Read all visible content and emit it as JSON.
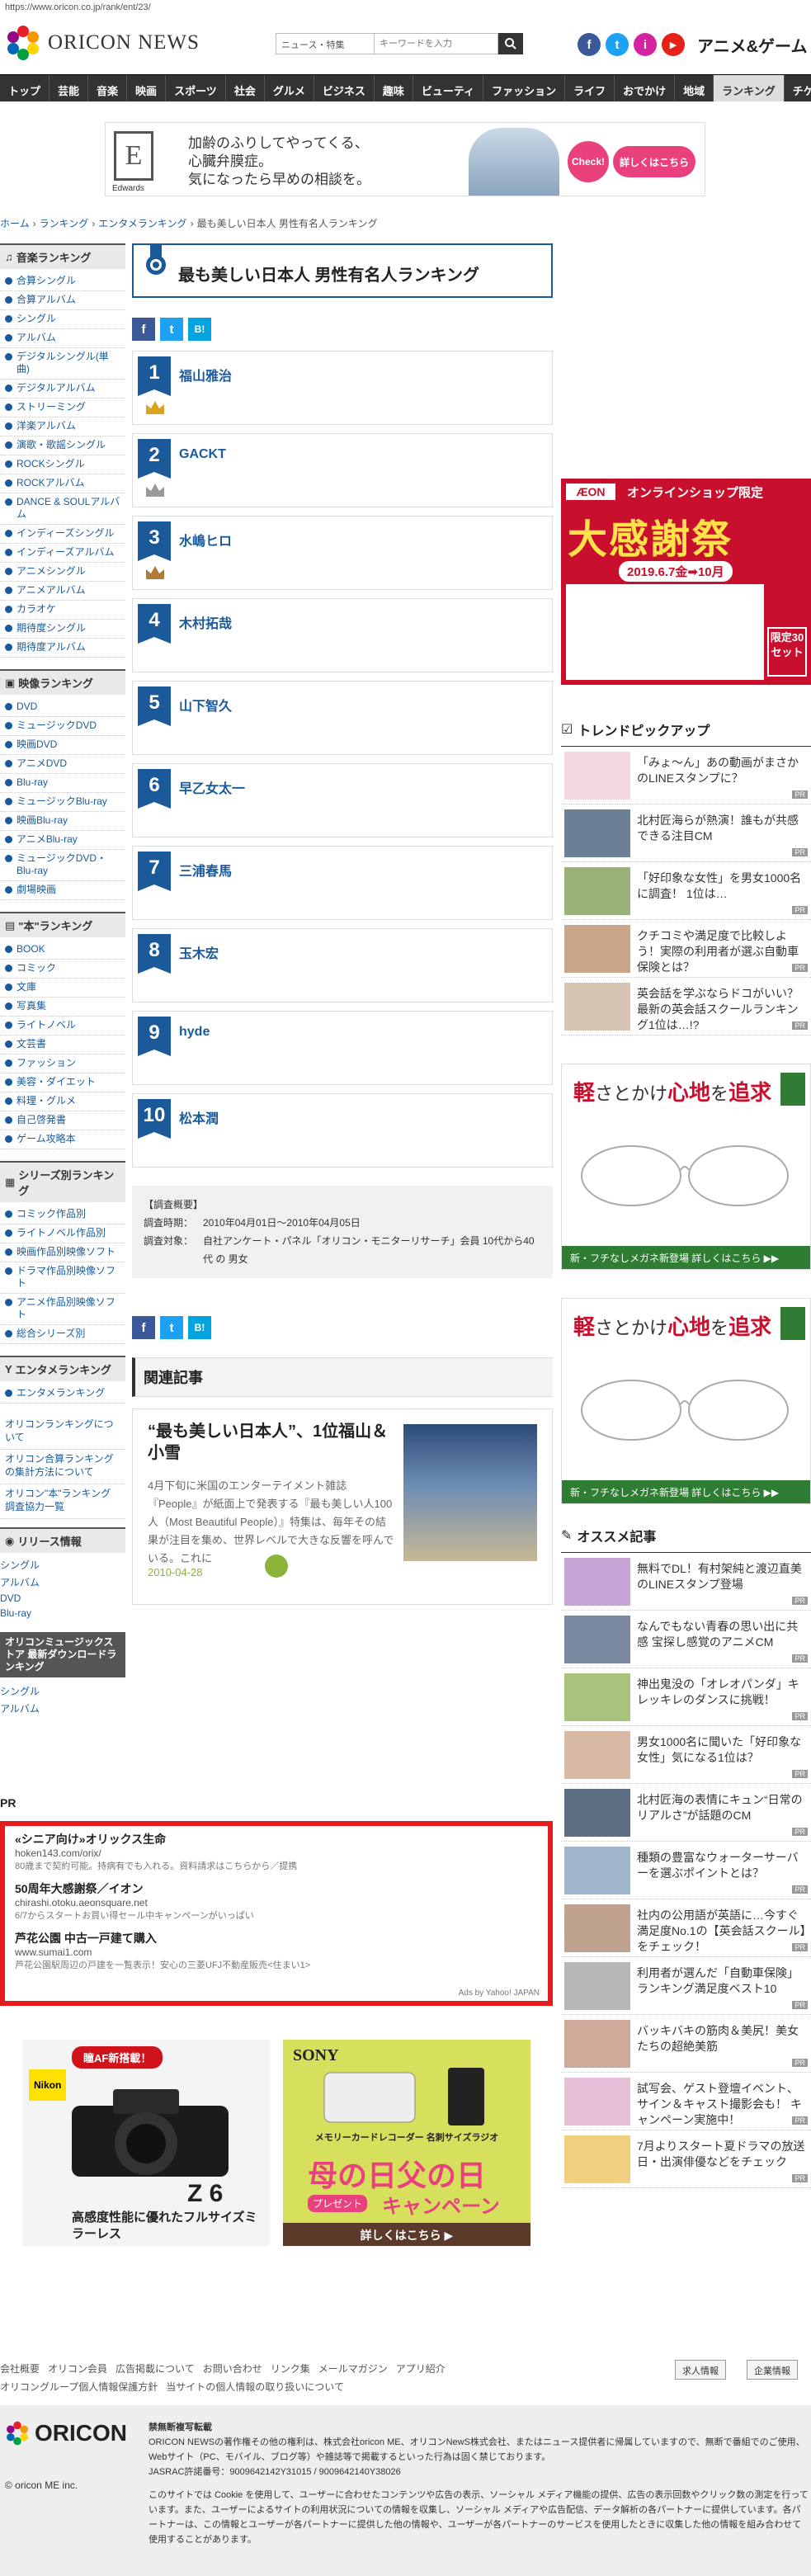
{
  "browser": {
    "url": "https://www.oricon.co.jp/rank/ent/23/"
  },
  "header": {
    "logo_text": "ORICON NEWS",
    "search_category": "ニュース・特集",
    "search_placeholder": "キーワードを入力",
    "sns": [
      "f",
      "t",
      "i",
      "▶"
    ],
    "anime_logo": "アニメ&ゲーム"
  },
  "nav": [
    "トップ",
    "芸能",
    "音楽",
    "映画",
    "スポーツ",
    "社会",
    "グルメ",
    "ビジネス",
    "趣味",
    "ビューティ",
    "ファッション",
    "ライフ",
    "おでかけ",
    "地域",
    "ランキング",
    "チケット"
  ],
  "nav_active": "ランキング",
  "banner_top": {
    "brand_letter": "E",
    "brand": "Edwards",
    "copy": [
      "加齢のふりしてやってくる、",
      "心臓弁膜症。",
      "気になったら早めの相談を。"
    ],
    "check": "Check!",
    "button": "詳しくはこちら"
  },
  "breadcrumb": [
    "ホーム",
    "›",
    "ランキング",
    "›",
    "エンタメランキング",
    "›",
    "最も美しい日本人 男性有名人ランキング"
  ],
  "sidebar": {
    "music_head": "音楽ランキング",
    "music": [
      "合算シングル",
      "合算アルバム",
      "シングル",
      "アルバム",
      "デジタルシングル(単曲)",
      "デジタルアルバム",
      "ストリーミング",
      "洋楽アルバム",
      "演歌・歌謡シングル",
      "ROCKシングル",
      "ROCKアルバム",
      "DANCE & SOULアルバム",
      "インディーズシングル",
      "インディーズアルバム",
      "アニメシングル",
      "アニメアルバム",
      "カラオケ",
      "期待度シングル",
      "期待度アルバム"
    ],
    "video_head": "映像ランキング",
    "video": [
      "DVD",
      "ミュージックDVD",
      "映画DVD",
      "アニメDVD",
      "Blu-ray",
      "ミュージックBlu-ray",
      "映画Blu-ray",
      "アニメBlu-ray",
      "ミュージックDVD・Blu-ray",
      "劇場映画"
    ],
    "book_head": "\"本\"ランキング",
    "book": [
      "BOOK",
      "コミック",
      "文庫",
      "写真集",
      "ライトノベル",
      "文芸書",
      "ファッション",
      "美容・ダイエット",
      "料理・グルメ",
      "自己啓発書",
      "ゲーム攻略本"
    ],
    "series_head": "シリーズ別ランキング",
    "series": [
      "コミック作品別",
      "ライトノベル作品別",
      "映画作品別映像ソフト",
      "ドラマ作品別映像ソフト",
      "アニメ作品別映像ソフト",
      "総合シリーズ別"
    ],
    "ent_head": "エンタメランキング",
    "ent": [
      "エンタメランキング"
    ],
    "links": [
      "オリコンランキングについて",
      "オリコン合算ランキングの集計方法について",
      "オリコン\"本\"ランキング調査協力一覧"
    ],
    "release_head": "リリース情報",
    "release": [
      "シングル",
      "アルバム",
      "DVD",
      "Blu-ray"
    ],
    "store_head": "オリコンミュージックストア 最新ダウンロードランキング",
    "store": [
      "シングル",
      "アルバム"
    ]
  },
  "main": {
    "title": "最も美しい日本人 男性有名人ランキング",
    "share": [
      "f",
      "t",
      "B!"
    ],
    "ranks": [
      {
        "rank": "1",
        "name": "福山雅治",
        "crown": "gold"
      },
      {
        "rank": "2",
        "name": "GACKT",
        "crown": "silver"
      },
      {
        "rank": "3",
        "name": "水嶋ヒロ",
        "crown": "bronze"
      },
      {
        "rank": "4",
        "name": "木村拓哉",
        "crown": ""
      },
      {
        "rank": "5",
        "name": "山下智久",
        "crown": ""
      },
      {
        "rank": "6",
        "name": "早乙女太一",
        "crown": ""
      },
      {
        "rank": "7",
        "name": "三浦春馬",
        "crown": ""
      },
      {
        "rank": "8",
        "name": "玉木宏",
        "crown": ""
      },
      {
        "rank": "9",
        "name": "hyde",
        "crown": ""
      },
      {
        "rank": "10",
        "name": "松本潤",
        "crown": ""
      }
    ],
    "survey": {
      "head": "【調査概要】",
      "period_label": "調査時期：",
      "period": "2010年04月01日～2010年04月05日",
      "target_label": "調査対象：",
      "target": "自社アンケート・パネル「オリコン・モニターリサーチ」会員 10代から40代 の 男女"
    },
    "related_head": "関連記事",
    "related": {
      "title": "“最も美しい日本人”、1位福山＆小雪",
      "body": "4月下旬に米国のエンターテイメント雑誌『People』が紙面上で発表する『最も美しい人100人（Most Beautiful People）』特集は、毎年その結果が注目を集め、世界レベルで大きな反響を呼んでいる。これに",
      "date": "2010-04-28"
    }
  },
  "right": {
    "aeon": {
      "logo": "ÆON",
      "top": "オンラインショップ限定",
      "big": "大感謝祭",
      "date": "2019.6.7金➡10月",
      "side": "限定30セット"
    },
    "trend_head": "トレンドピックアップ",
    "trend": [
      "「みょ～ん」あの動画がまさかのLINEスタンプに？",
      "北村匠海らが熱演！誰もが共感できる注目CM",
      "「好印象な女性」を男女1000名に調査！ 1位は…",
      "クチコミや満足度で比較しよう！実際の利用者が選ぶ自動車保険とは？",
      "英会話を学ぶならドコがいい？最新の英会話スクールランキング1位は…!?"
    ],
    "glass": {
      "title_a": "軽",
      "title_b": "さとかけ",
      "title_c": "心地",
      "title_d": "を",
      "title_e": "追求",
      "foot": "新・フチなしメガネ新登場 詳しくはこちら ▶▶"
    },
    "osusume_head": "オススメ記事",
    "osusume": [
      "無料でDL！有村架純と渡辺直美のLINEスタンプ登場",
      "なんでもない青春の思い出に共感 宝探し感覚のアニメCM",
      "神出鬼没の「オレオパンダ」キレッキレのダンスに挑戦！",
      "男女1000名に聞いた「好印象な女性」気になる1位は？",
      "北村匠海の表情にキュン“日常のリアルさ”が話題のCM",
      "種類の豊富なウォーターサーバーを選ぶポイントとは？",
      "社内の公用語が英語に…今すぐ満足度No.1の【英会話スクール】をチェック！",
      "利用者が選んだ「自動車保険」ランキング満足度ベスト10",
      "バッキバキの筋肉＆美尻！美女たちの超絶美筋",
      "試写会、ゲスト登壇イベント、サイン＆キャスト撮影会も！ キャンペーン実施中！",
      "7月よりスタート夏ドラマの放送日・出演俳優などをチェック"
    ],
    "pr": "PR"
  },
  "pr": {
    "label": "PR",
    "ads": [
      {
        "title": "«シニア向け»オリックス生命",
        "url": "hoken143.com/orix/",
        "desc": "80歳まで契約可能。持病有でも入れる。資料請求はこちらから／提携"
      },
      {
        "title": "50周年大感謝祭／イオン",
        "url": "chirashi.otoku.aeonsquare.net",
        "desc": "6/7からスタートお買い得セール中キャンペーンがいっぱい"
      },
      {
        "title": "芦花公園 中古一戸建て購入",
        "url": "www.sumai1.com",
        "desc": "芦花公園駅周辺の戸建を一覧表示！安心の三菱UFJ不動産販売<住まい1>"
      }
    ],
    "yahoo": "Ads by Yahoo! JAPAN"
  },
  "ads_bottom": {
    "nikon": {
      "badge": "瞳AF新搭載！",
      "brand": "Nikon",
      "model": "Z 6",
      "copy": "高感度性能に優れたフルサイズミラーレス"
    },
    "sony": {
      "brand": "SONY",
      "sub": "メモリーカードレコーダー 名刺サイズラジオ",
      "main": "母の日父の日",
      "campaign": "キャンペーン",
      "gift": "プレゼント",
      "btn": "詳しくはこちら ▶"
    }
  },
  "footer": {
    "links1": [
      "会社概要",
      "オリコン会員",
      "広告掲載について",
      "お問い合わせ",
      "リンク集",
      "メールマガジン",
      "アプリ紹介"
    ],
    "links2": [
      "オリコングループ個人情報保護方針",
      "当サイトの個人情報の取り扱いについて"
    ],
    "btn_jobs": "求人情報",
    "btn_corp": "企業情報",
    "logo": "ORICON",
    "copyright": "© oricon ME inc.",
    "legal_head": "禁無断複写転載",
    "legal": "ORICON NEWSの著作権その他の権利は、株式会社oricon ME、オリコンNewS株式会社、またはニュース提供者に帰属していますので、無断で番組でのご使用、Webサイト（PC、モバイル、ブログ等）や雑誌等で掲載するといった行為は固く禁じております。",
    "jasrac": "JASRAC許諾番号：9009642142Y31015 / 9009642140Y38026",
    "cookie": "このサイトでは Cookie を使用して、ユーザーに合わせたコンテンツや広告の表示、ソーシャル メディア機能の提供、広告の表示回数やクリック数の測定を行っています。また、ユーザーによるサイトの利用状況についての情報を収集し、ソーシャル メディアや広告配信、データ解析の各パートナーに提供しています。各パートナーは、この情報とユーザーが各パートナーに提供した他の情報や、ユーザーが各パートナーのサービスを使用したときに収集した他の情報を組み合わせて使用することがあります。"
  },
  "colors": {
    "accent": "#1a5a9a",
    "nav": "#333333",
    "pr_border": "#e51b1b"
  }
}
